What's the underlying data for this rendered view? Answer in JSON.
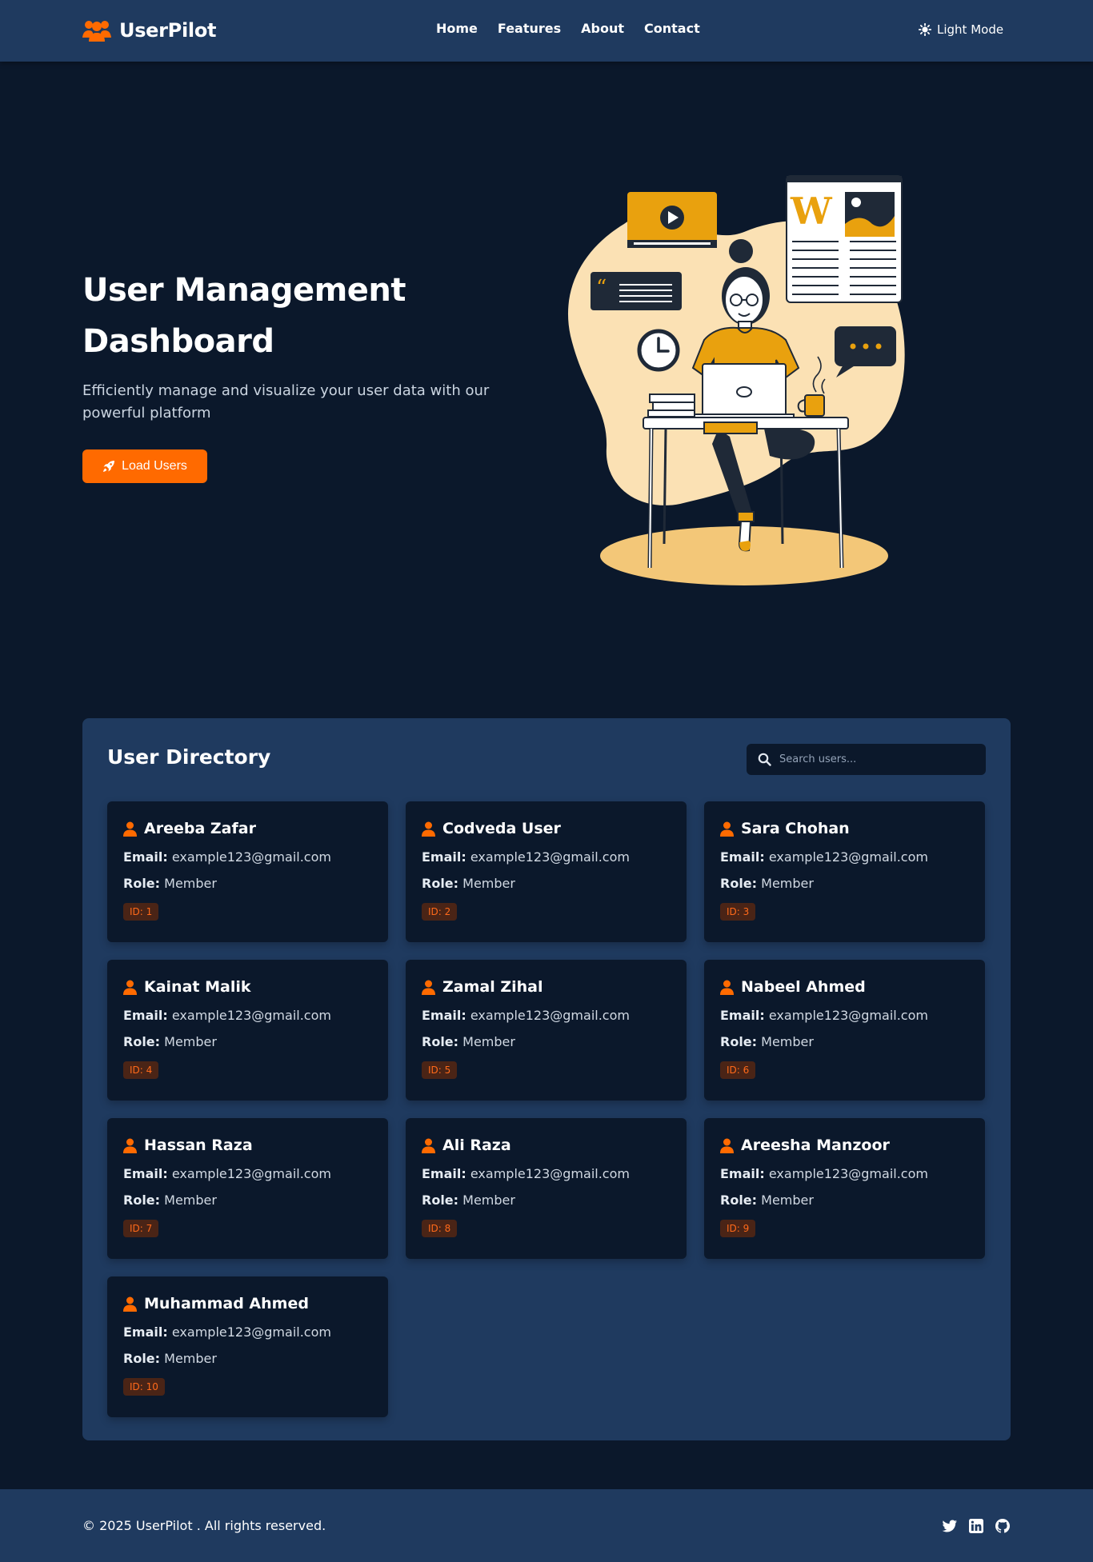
{
  "navbar": {
    "brand": "UserPilot",
    "links": [
      "Home",
      "Features",
      "About",
      "Contact"
    ],
    "mode_toggle": "Light Mode"
  },
  "hero": {
    "title": "User Management Dashboard",
    "subtitle": "Efficiently manage and visualize your user data with our powerful platform",
    "button_label": "Load Users"
  },
  "directory": {
    "title": "User Directory",
    "search_placeholder": "Search users...",
    "email_label": "Email:",
    "role_label": "Role:",
    "users": [
      {
        "name": "Areeba Zafar",
        "email": "example123@gmail.com",
        "role": "Member",
        "id": "ID: 1"
      },
      {
        "name": "Codveda User",
        "email": "example123@gmail.com",
        "role": "Member",
        "id": "ID: 2"
      },
      {
        "name": "Sara Chohan",
        "email": "example123@gmail.com",
        "role": "Member",
        "id": "ID: 3"
      },
      {
        "name": "Kainat Malik",
        "email": "example123@gmail.com",
        "role": "Member",
        "id": "ID: 4"
      },
      {
        "name": "Zamal Zihal",
        "email": "example123@gmail.com",
        "role": "Member",
        "id": "ID: 5"
      },
      {
        "name": "Nabeel Ahmed",
        "email": "example123@gmail.com",
        "role": "Member",
        "id": "ID: 6"
      },
      {
        "name": "Hassan Raza",
        "email": "example123@gmail.com",
        "role": "Member",
        "id": "ID: 7"
      },
      {
        "name": "Ali Raza",
        "email": "example123@gmail.com",
        "role": "Member",
        "id": "ID: 8"
      },
      {
        "name": "Areesha Manzoor",
        "email": "example123@gmail.com",
        "role": "Member",
        "id": "ID: 9"
      },
      {
        "name": "Muhammad Ahmed",
        "email": "example123@gmail.com",
        "role": "Member",
        "id": "ID: 10"
      }
    ]
  },
  "footer": {
    "copyright": "© 2025 UserPilot . All rights reserved.",
    "socials": [
      "twitter-icon",
      "linkedin-icon",
      "github-icon"
    ]
  },
  "colors": {
    "background": "#0b182b",
    "panel": "#1f3a5f",
    "accent": "#ff6a00",
    "illustration_yellow": "#e9a10e",
    "illustration_cream": "#fbe1b4"
  }
}
